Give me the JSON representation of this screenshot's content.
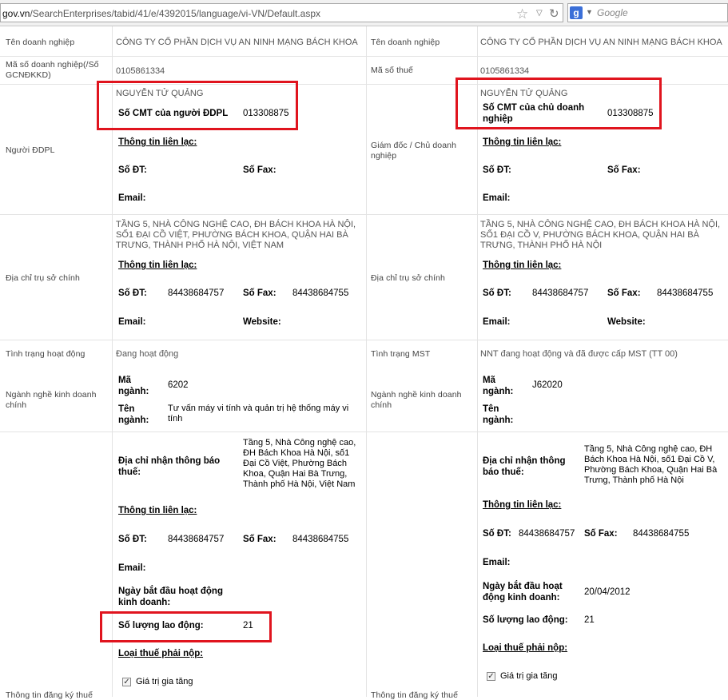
{
  "browser": {
    "url_prefix": "gov.vn",
    "url_rest": "/SearchEnterprises/tabid/41/e/4392015/language/vi-VN/Default.aspx",
    "search_placeholder": "Google"
  },
  "left": {
    "ten_dn_label": "Tên doanh nghiệp",
    "ten_dn_value": "CÔNG TY CỔ PHẦN DỊCH VỤ AN NINH MẠNG BÁCH KHOA",
    "ma_so_label": "Mã số doanh nghiệp(/Số GCNĐKKD)",
    "ma_so_value": "0105861334",
    "nguoi_label": "Người ĐDPL",
    "nguoi_name": "NGUYỄN TỬ QUẢNG",
    "cmt_label": "Số CMT của người ĐDPL",
    "cmt_value": "013308875",
    "lien_lac": "Thông tin liên lạc:",
    "so_dt": "Số ĐT:",
    "so_fax": "Số Fax:",
    "email": "Email:",
    "dia_chi_label": "Địa chỉ trụ sở chính",
    "dia_chi_value": "TẦNG 5, NHÀ CÔNG NGHỆ CAO, ĐH BÁCH KHOA HÀ NỘI, SỐ1 ĐẠI CỒ VIỆT, PHƯỜNG BÁCH KHOA, QUẬN HAI BÀ TRƯNG, THÀNH PHỐ HÀ NỘI, VIỆT NAM",
    "lien_lac2": "Thông tin liên lạc:",
    "so_dt2": "Số ĐT:",
    "so_dt2_value": "84438684757",
    "so_fax2": "Số Fax:",
    "so_fax2_value": "84438684755",
    "email2": "Email:",
    "website": "Website:",
    "tinh_trang_label": "Tình trạng hoạt động",
    "tinh_trang_value": "Đang hoạt động",
    "nganh_label": "Ngành nghề kinh doanh chính",
    "ma_nganh": "Mã ngành:",
    "ma_nganh_value": "6202",
    "ten_nganh": "Tên ngành:",
    "ten_nganh_value": "Tư vấn máy vi tính và quản trị hệ thống máy vi tính",
    "thue_label": "Thông tin đăng ký thuế",
    "dc_thue_label": "Địa chỉ nhận thông báo thuế:",
    "dc_thue_value": "Tầng 5, Nhà Công nghệ cao, ĐH Bách Khoa Hà Nội, số1 Đại Cồ Việt, Phường Bách Khoa, Quận Hai Bà Trưng, Thành phố Hà Nội, Việt Nam",
    "lien_lac3": "Thông tin liên lạc:",
    "so_dt3": "Số ĐT:",
    "so_dt3_value": "84438684757",
    "so_fax3": "Số Fax:",
    "so_fax3_value": "84438684755",
    "email3": "Email:",
    "ngay_bd": "Ngày bắt đầu hoạt động kinh doanh:",
    "so_luong_label": "Số lượng lao động:",
    "so_luong_value": "21",
    "loai_thue": "Loại thuế phải nộp:",
    "gtgt": "Giá trị gia tăng"
  },
  "right": {
    "ten_dn_label": "Tên doanh nghiệp",
    "ten_dn_value": "CÔNG TY CỔ PHẦN DỊCH VỤ AN NINH MẠNG BÁCH KHOA",
    "mst_label": "Mã số thuế",
    "mst_value": "0105861334",
    "gd_label": "Giám đốc / Chủ doanh nghiệp",
    "gd_name": "NGUYỄN TỬ QUẢNG",
    "cmt_label": "Số CMT của chủ doanh nghiệp",
    "cmt_value": "013308875",
    "lien_lac": "Thông tin liên lạc:",
    "so_dt": "Số ĐT:",
    "so_fax": "Số Fax:",
    "email": "Email:",
    "dia_chi_label": "Địa chỉ trụ sở chính",
    "dia_chi_value": "TẦNG 5, NHÀ CÔNG NGHỆ CAO, ĐH BÁCH KHOA HÀ NỘI, SỐ1 ĐẠI CỒ V, PHƯỜNG BÁCH KHOA, QUẬN HAI BÀ TRƯNG, THÀNH PHỐ HÀ NỘI",
    "lien_lac2": "Thông tin liên lạc:",
    "so_dt2": "Số ĐT:",
    "so_dt2_value": "84438684757",
    "so_fax2": "Số Fax:",
    "so_fax2_value": "84438684755",
    "email2": "Email:",
    "website": "Website:",
    "tinh_trang_label": "Tình trạng MST",
    "tinh_trang_value": "NNT đang hoạt động và đã được cấp MST (TT 00)",
    "nganh_label": "Ngành nghề kinh doanh chính",
    "ma_nganh": "Mã ngành:",
    "ma_nganh_value": "J62020",
    "ten_nganh": "Tên ngành:",
    "thue_label": "Thông tin đăng ký thuế",
    "dc_thue_label": "Địa chỉ nhận thông báo thuế:",
    "dc_thue_value": "Tầng 5, Nhà Công nghệ cao, ĐH Bách Khoa Hà Nội, số1 Đại Cồ V, Phường Bách Khoa, Quận Hai Bà Trưng, Thành phố Hà Nội",
    "lien_lac3": "Thông tin liên lạc:",
    "so_dt3": "Số ĐT:",
    "so_dt3_value": "84438684757",
    "so_fax3": "Số Fax:",
    "so_fax3_value": "84438684755",
    "email3": "Email:",
    "ngay_bd": "Ngày bắt đầu hoạt động kinh doanh:",
    "ngay_bd_value": "20/04/2012",
    "so_luong_label": "Số lượng lao động:",
    "so_luong_value": "21",
    "loai_thue": "Loại thuế phải nộp:",
    "gtgt": "Giá trị gia tăng"
  }
}
